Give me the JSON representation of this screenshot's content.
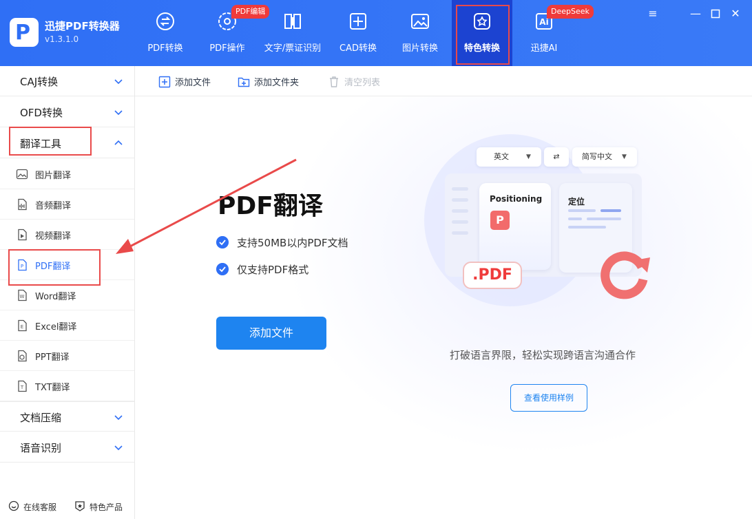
{
  "app": {
    "name": "迅捷PDF转换器",
    "version": "v1.3.1.0",
    "logo_letter": "P"
  },
  "nav": [
    {
      "label": "PDF转换",
      "icon": "pdf-convert-icon"
    },
    {
      "label": "PDF操作",
      "icon": "pdf-operate-icon",
      "badge": "PDF编辑"
    },
    {
      "label": "文字/票证识别",
      "icon": "text-recognize-icon"
    },
    {
      "label": "CAD转换",
      "icon": "cad-icon"
    },
    {
      "label": "图片转换",
      "icon": "image-icon"
    },
    {
      "label": "特色转换",
      "icon": "feature-icon",
      "active": true
    },
    {
      "label": "迅捷AI",
      "icon": "ai-icon",
      "badge": "DeepSeek"
    }
  ],
  "window_controls": [
    "menu-icon",
    "minimize-icon",
    "maximize-icon",
    "close-icon"
  ],
  "sidebar": {
    "groups_top": [
      {
        "label": "CAJ转换"
      },
      {
        "label": "OFD转换"
      },
      {
        "label": "翻译工具",
        "expanded": true
      }
    ],
    "sub_items": [
      {
        "label": "图片翻译",
        "icon": "image-translate-icon"
      },
      {
        "label": "音频翻译",
        "icon": "audio-translate-icon"
      },
      {
        "label": "视频翻译",
        "icon": "video-translate-icon"
      },
      {
        "label": "PDF翻译",
        "icon": "pdf-translate-icon",
        "active": true
      },
      {
        "label": "Word翻译",
        "icon": "word-translate-icon"
      },
      {
        "label": "Excel翻译",
        "icon": "excel-translate-icon"
      },
      {
        "label": "PPT翻译",
        "icon": "ppt-translate-icon"
      },
      {
        "label": "TXT翻译",
        "icon": "txt-translate-icon"
      }
    ],
    "groups_bottom": [
      {
        "label": "文档压缩"
      },
      {
        "label": "语音识别"
      }
    ],
    "footer": {
      "support": "在线客服",
      "featured": "特色产品"
    }
  },
  "toolbar": {
    "add_file": "添加文件",
    "add_folder": "添加文件夹",
    "clear_list": "清空列表"
  },
  "main": {
    "title": "PDF翻译",
    "features": [
      "支持50MB以内PDF文档",
      "仅支持PDF格式"
    ],
    "add_button": "添加文件",
    "tagline": "打破语言界限，轻松实现跨语言沟通合作",
    "example_button": "查看使用样例"
  },
  "illustration": {
    "source_lang": "英文",
    "target_lang": "简写中文",
    "card_en": "Positioning",
    "card_zh": "定位",
    "pdf_tag": ".PDF"
  },
  "colors": {
    "header": "#2f6ff5",
    "active_nav": "#1c43d1",
    "primary": "#1e84f0",
    "highlight": "#e94a4a",
    "badge": "#ef3b3b"
  }
}
